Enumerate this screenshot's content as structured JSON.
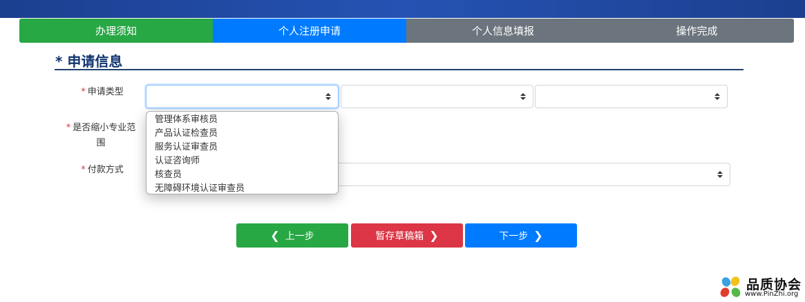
{
  "steps": [
    {
      "label": "办理须知",
      "color": "#28a745",
      "state": "done"
    },
    {
      "label": "个人注册申请",
      "color": "#007bff",
      "state": "active"
    },
    {
      "label": "个人信息填报",
      "color": "#6c757d",
      "state": "pending"
    },
    {
      "label": "操作完成",
      "color": "#6c757d",
      "state": "pending"
    }
  ],
  "section": {
    "title": "* 申请信息"
  },
  "form": {
    "required_mark": "*",
    "apply_type": {
      "label": "申请类型",
      "value": "",
      "sub1_value": "",
      "sub2_value": ""
    },
    "narrow_scope": {
      "label_line1": "是否缩小专业范",
      "label_line2": "围"
    },
    "payment": {
      "label": "付款方式",
      "value": ""
    }
  },
  "dropdown": {
    "open": true,
    "options": [
      "管理体系审核员",
      "产品认证检查员",
      "服务认证审查员",
      "认证咨询师",
      "核查员",
      "无障碍环境认证审查员"
    ]
  },
  "buttons": {
    "prev": {
      "label": "上一步",
      "icon": "chevron-left-icon",
      "color": "#28a745"
    },
    "draft": {
      "label": "暂存草稿箱",
      "icon": "chevron-right-icon",
      "color": "#dc3545"
    },
    "next": {
      "label": "下一步",
      "icon": "chevron-right-icon",
      "color": "#007bff"
    }
  },
  "watermark": {
    "title": "品质协会",
    "url": "www.PinZhi.org"
  }
}
